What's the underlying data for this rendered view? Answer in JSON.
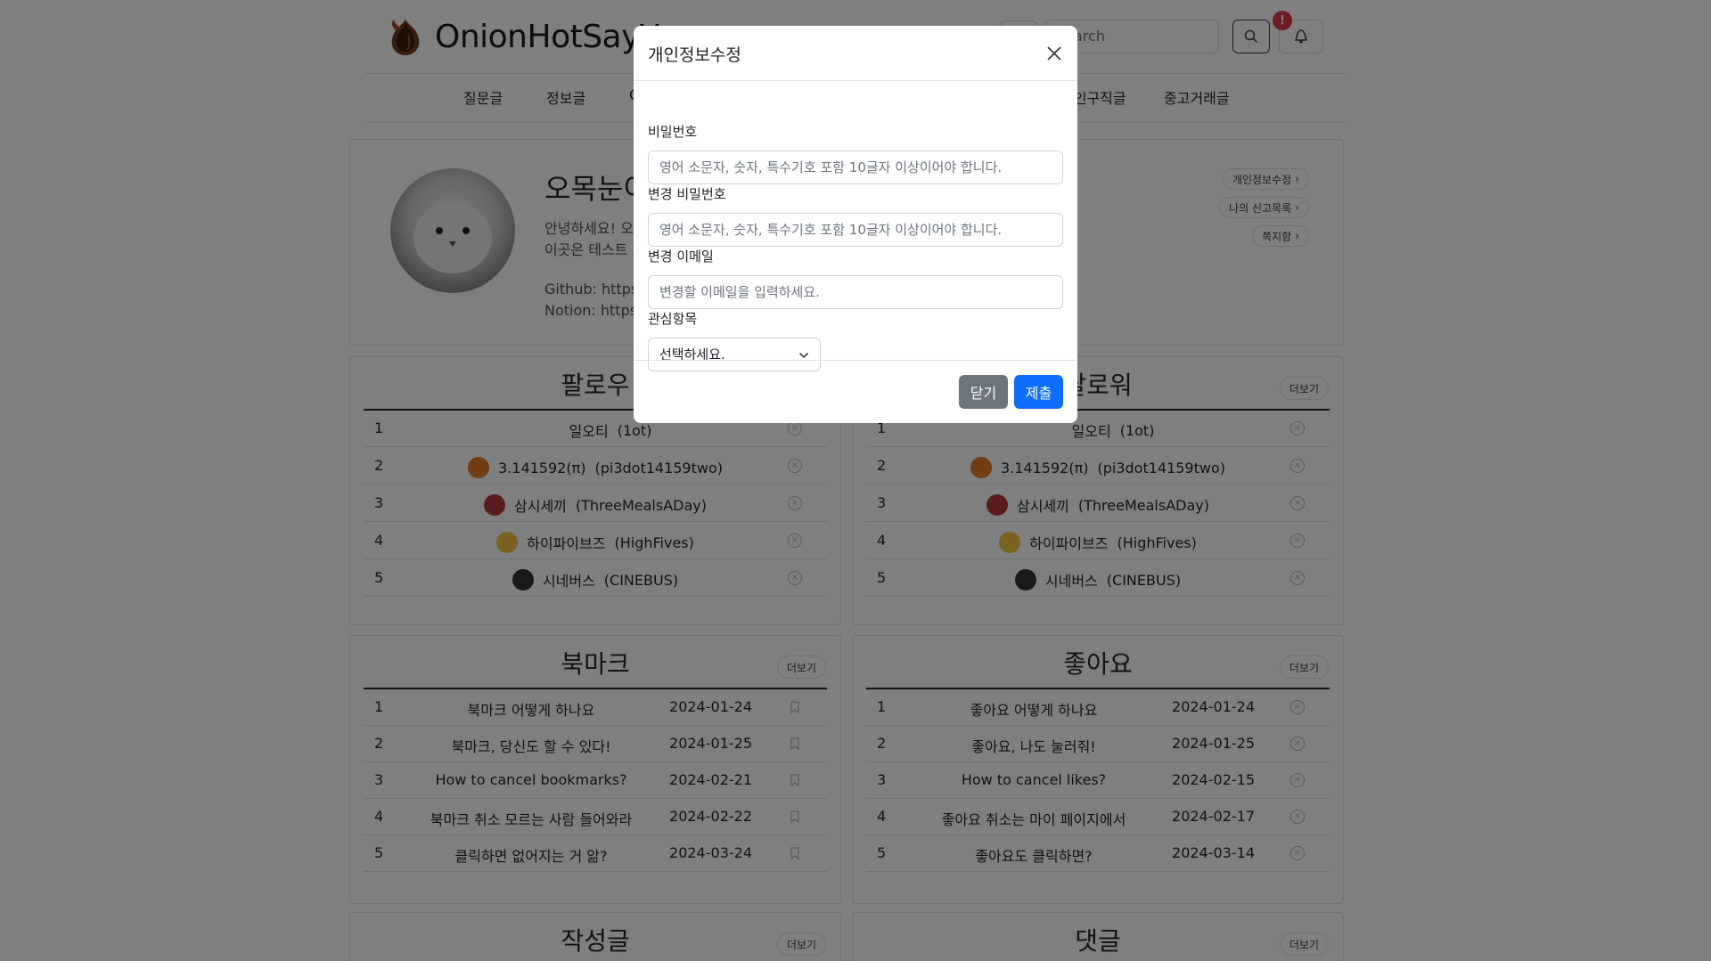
{
  "header": {
    "logo_text": "OnionHotSayYo",
    "search_placeholder": "Search",
    "alarm_badge": "!"
  },
  "nav": [
    "질문글",
    "정보글",
    "Q",
    "구인구직글",
    "중고거래글"
  ],
  "profile": {
    "name": "오목눈이",
    "bio_line1": "안녕하세요! 오목눈이입니다.",
    "bio_line2": "이곳은 테스트 프로필입니다.",
    "github": "Github: https://github.com",
    "notion": "Notion: https://notion.so",
    "links": [
      "개인정보수정",
      "나의 신고목록",
      "쪽지함"
    ]
  },
  "sections": {
    "more_label": "더보기",
    "follow_title": "팔로우",
    "follower_title": "팔로워",
    "users": [
      {
        "idx": "1",
        "name": "일오티",
        "handle": "(1ot)",
        "icon": "1ot-icon",
        "color": "#ffffff"
      },
      {
        "idx": "2",
        "name": "3.141592(π)",
        "handle": "(pi3dot14159two)",
        "icon": "pie-icon",
        "color": "#e07b2b"
      },
      {
        "idx": "3",
        "name": "삼시세끼",
        "handle": "(ThreeMealsADay)",
        "icon": "meal-icon",
        "color": "#b23a3a"
      },
      {
        "idx": "4",
        "name": "하이파이브즈",
        "handle": "(HighFives)",
        "icon": "raised-hands-icon",
        "color": "#f4c542"
      },
      {
        "idx": "5",
        "name": "시네버스",
        "handle": "(CINEBUS)",
        "icon": "film-camera-icon",
        "color": "#333333"
      }
    ],
    "bookmark_title": "북마크",
    "bookmarks": [
      {
        "idx": "1",
        "title": "북마크 어떻게 하나요",
        "date": "2024-01-24"
      },
      {
        "idx": "2",
        "title": "북마크, 당신도 할 수 있다!",
        "date": "2024-01-25"
      },
      {
        "idx": "3",
        "title": "How to cancel bookmarks?",
        "date": "2024-02-21"
      },
      {
        "idx": "4",
        "title": "북마크 취소 모르는 사람 들어와라",
        "date": "2024-02-22"
      },
      {
        "idx": "5",
        "title": "클릭하면 없어지는 거 앎?",
        "date": "2024-03-24"
      }
    ],
    "like_title": "좋아요",
    "likes": [
      {
        "idx": "1",
        "title": "좋아요 어떻게 하나요",
        "date": "2024-01-24"
      },
      {
        "idx": "2",
        "title": "좋아요, 나도 눌러줘!",
        "date": "2024-01-25"
      },
      {
        "idx": "3",
        "title": "How to cancel likes?",
        "date": "2024-02-15"
      },
      {
        "idx": "4",
        "title": "좋아요 취소는 마이 페이지에서",
        "date": "2024-02-17"
      },
      {
        "idx": "5",
        "title": "좋아요도 클릭하면?",
        "date": "2024-03-14"
      }
    ],
    "posts_title": "작성글",
    "comments_title": "댓글"
  },
  "modal": {
    "title": "개인정보수정",
    "password_label": "비밀번호",
    "password_placeholder": "영어 소문자, 숫자, 특수기호 포함 10글자 이상이어야 합니다.",
    "new_password_label": "변경 비밀번호",
    "new_password_placeholder": "영어 소문자, 숫자, 특수기호 포함 10글자 이상이어야 합니다.",
    "email_label": "변경 이메일",
    "email_placeholder": "변경할 이메일을 입력하세요.",
    "interest_label": "관심항목",
    "interest_selected": "선택하세요.",
    "close_button": "닫기",
    "submit_button": "제출"
  }
}
